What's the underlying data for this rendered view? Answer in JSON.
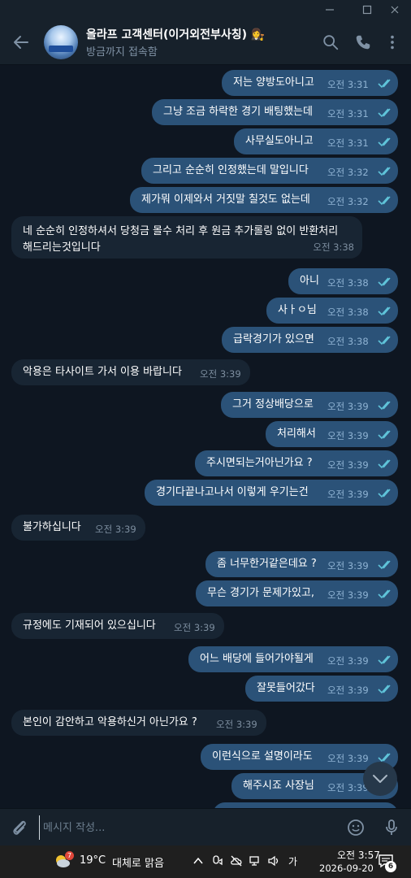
{
  "chat": {
    "title": "올라프 고객센터(이거외전부사칭)",
    "title_emoji": "👩‍⚖️",
    "status": "방금까지 접속함",
    "avatar_text": "올라프"
  },
  "messages": [
    {
      "side": "out",
      "text": "저는 양방도아니고",
      "time": "오전 3:31"
    },
    {
      "side": "out",
      "text": "그냥 조금 하락한 경기 배팅했는데",
      "time": "오전 3:31"
    },
    {
      "side": "out",
      "text": "사무실도아니고",
      "time": "오전 3:31"
    },
    {
      "side": "out",
      "text": "그리고 순순히 인정했는데 말입니다",
      "time": "오전 3:32"
    },
    {
      "side": "out",
      "text": "제가뭐 이제와서 거짓말 칠것도 없는데",
      "time": "오전 3:32"
    },
    {
      "side": "in",
      "line1": "네 순순히 인정하셔서 당청금 몰수 처리 후 원금 추가롤링 없이 반환처리",
      "line2": "해드리는것입니다",
      "time": "오전 3:38"
    },
    {
      "side": "out",
      "text": "아니",
      "time": "오전 3:38"
    },
    {
      "side": "out",
      "text": "사ㅏㅇ님",
      "time": "오전 3:38"
    },
    {
      "side": "out",
      "text": "급락경기가 있으면",
      "time": "오전 3:38"
    },
    {
      "side": "in",
      "text": "악용은 타사이트 가서 이용 바랍니다",
      "time": "오전 3:39"
    },
    {
      "side": "out",
      "text": "그거 정상배당으로",
      "time": "오전 3:39"
    },
    {
      "side": "out",
      "text": "처리해서",
      "time": "오전 3:39"
    },
    {
      "side": "out",
      "text": "주시면되는거아닌가요 ?",
      "time": "오전 3:39"
    },
    {
      "side": "out",
      "text": "경기다끝나고나서 이렇게 우기는건",
      "time": "오전 3:39"
    },
    {
      "side": "in",
      "text": "불가하십니다",
      "time": "오전 3:39"
    },
    {
      "side": "out",
      "text": "좀 너무한거같은데요 ?",
      "time": "오전 3:39"
    },
    {
      "side": "out",
      "text": "무슨 경기가 문제가있고,",
      "time": "오전 3:39"
    },
    {
      "side": "in",
      "text": "규정에도 기재되어 있으십니다",
      "time": "오전 3:39"
    },
    {
      "side": "out",
      "text": "어느 배당에 들어가야될게",
      "time": "오전 3:39"
    },
    {
      "side": "out",
      "text": "잘못들어갔다",
      "time": "오전 3:39"
    },
    {
      "side": "in",
      "text": "본인이 감안하고 악용하신거 아닌가요 ?",
      "time": "오전 3:39"
    },
    {
      "side": "out",
      "text": "이런식으로 설명이라도",
      "time": "오전 3:39"
    },
    {
      "side": "out",
      "text": "해주시죠 사장님",
      "time": "오전 3:39"
    }
  ],
  "input": {
    "placeholder": "메시지 작성..."
  },
  "taskbar": {
    "temperature": "19°C",
    "weather": "대체로 맑음",
    "weather_badge": "7",
    "ime": "가",
    "time": "오전 3:57",
    "date": "2026-09-20",
    "notification_count": "6"
  },
  "colors": {
    "background": "#0e1621",
    "header": "#17212b",
    "outgoing_bubble": "#2b5278",
    "incoming_bubble": "#182533",
    "read_ticks": "#5fc3d9"
  }
}
